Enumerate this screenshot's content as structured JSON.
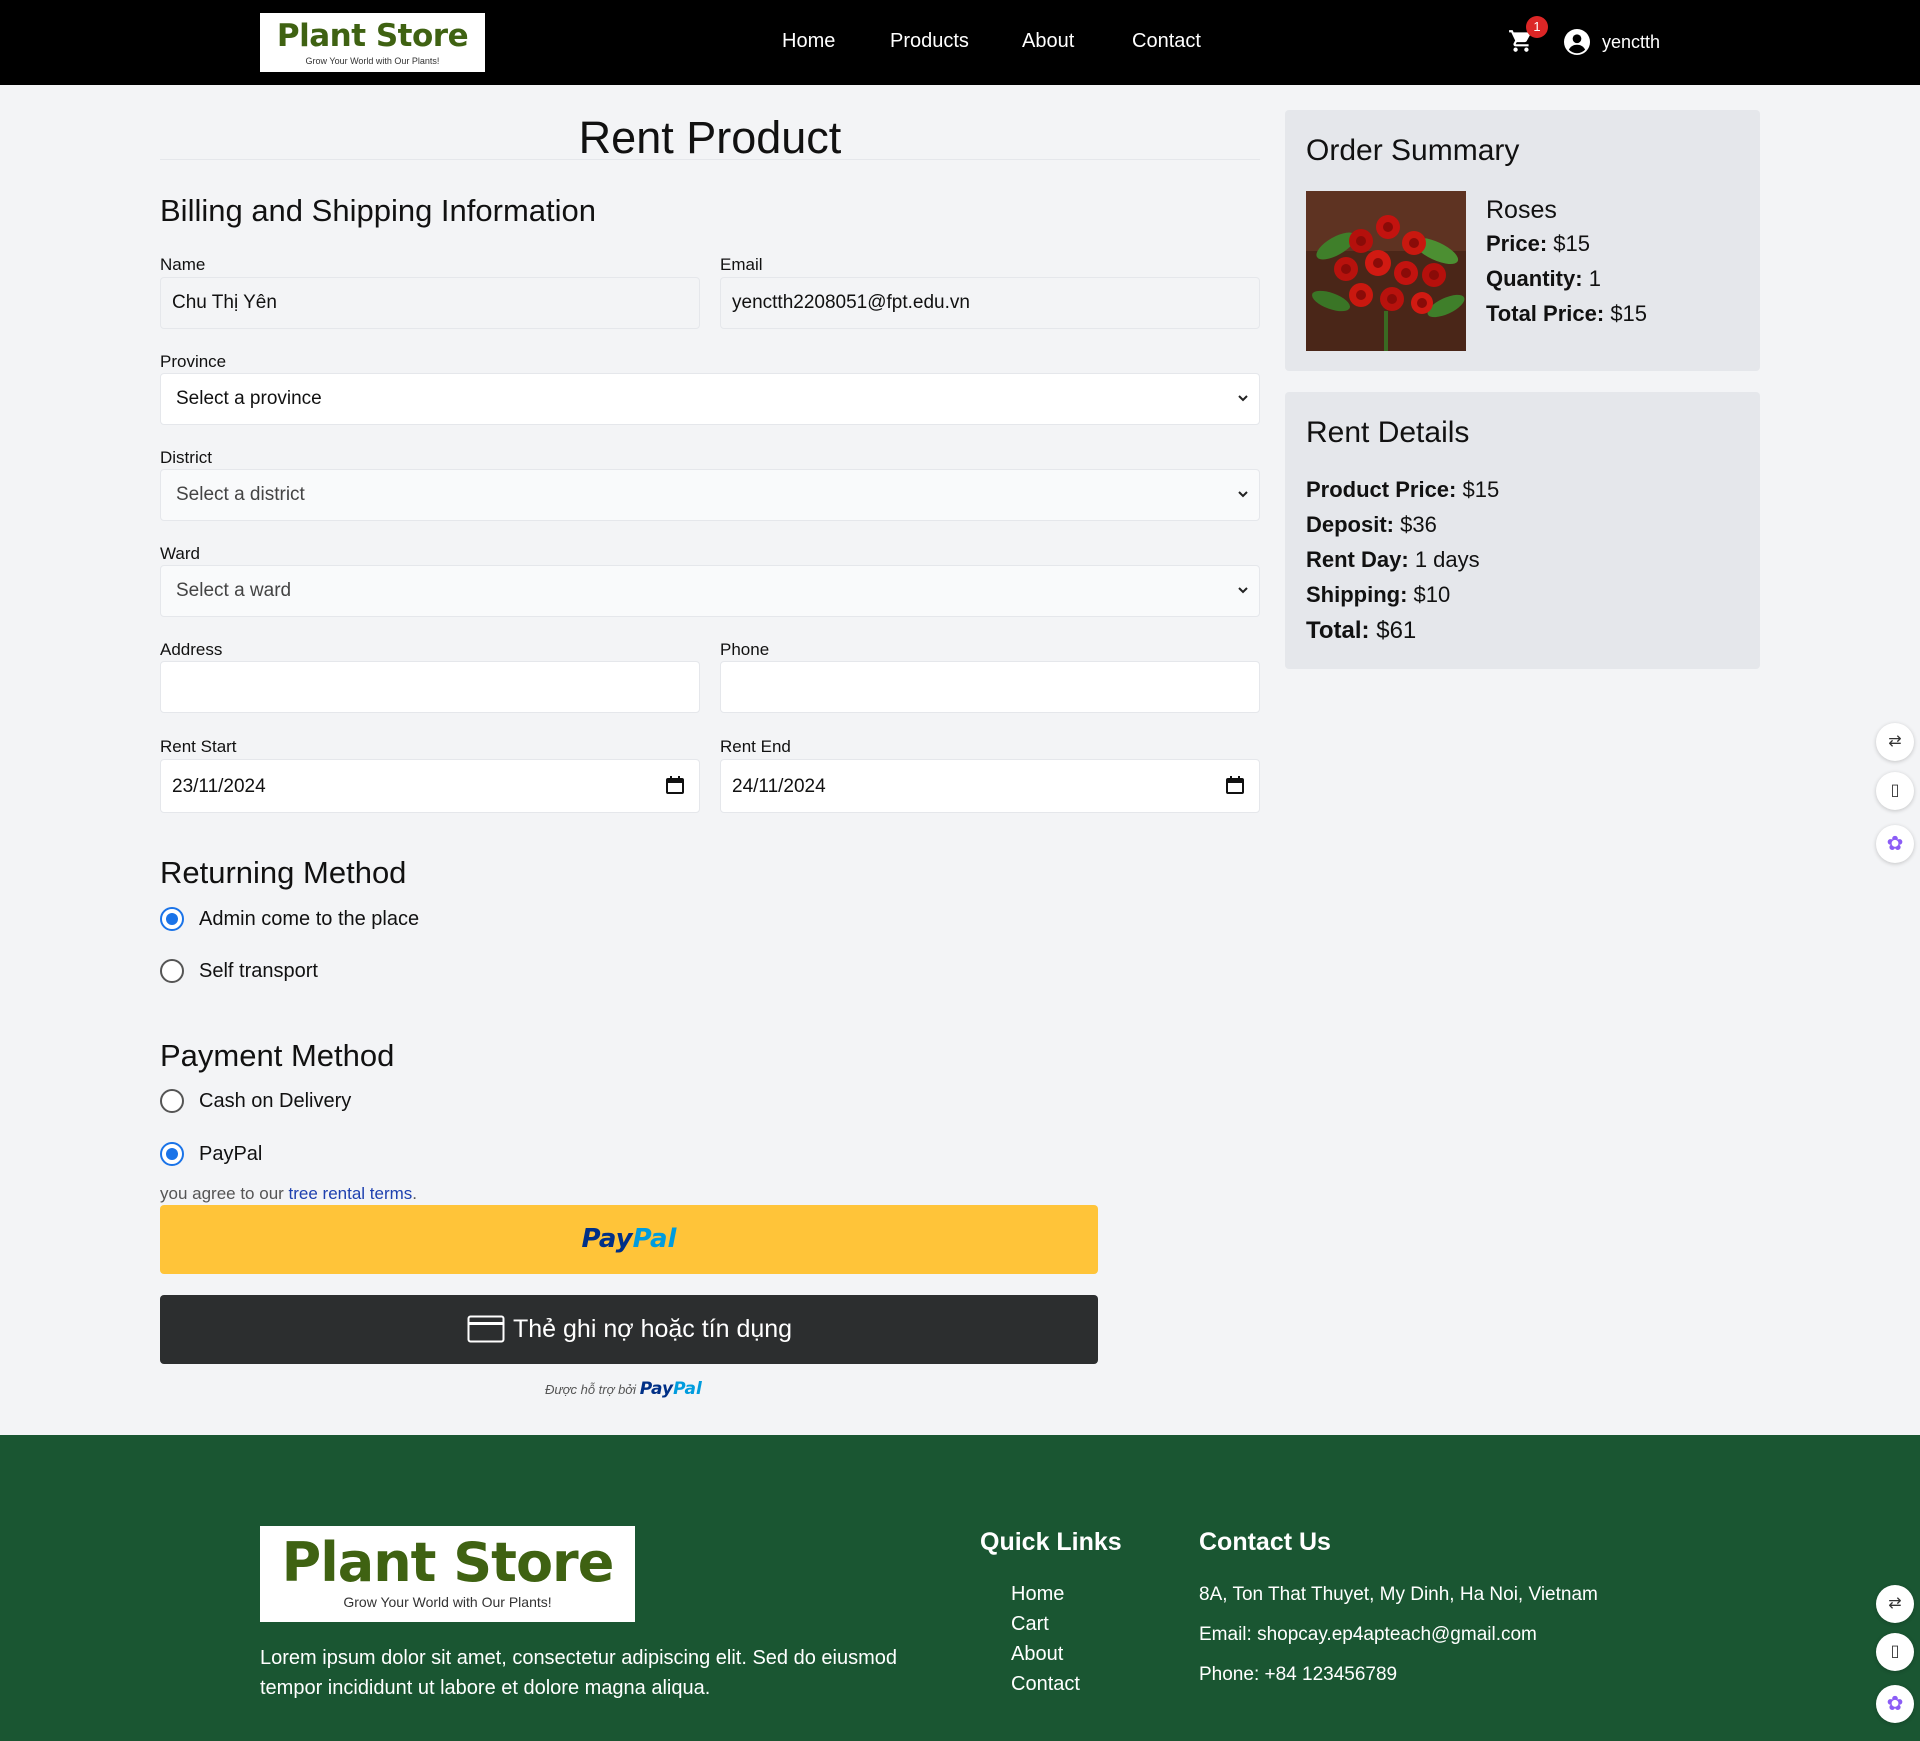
{
  "header": {
    "logo_title": "Plant Store",
    "logo_slogan": "Grow Your World with Our Plants!",
    "nav": [
      "Home",
      "Products",
      "About",
      "Contact"
    ],
    "cart_count": "1",
    "username": "yenctth"
  },
  "form": {
    "page_title": "Rent Product",
    "billing_heading": "Billing and Shipping Information",
    "name_label": "Name",
    "name_value": "Chu Thị Yên",
    "email_label": "Email",
    "email_value": "yenctth2208051@fpt.edu.vn",
    "province_label": "Province",
    "province_value": "Select a province",
    "district_label": "District",
    "district_value": "Select a district",
    "ward_label": "Ward",
    "ward_value": "Select a ward",
    "address_label": "Address",
    "address_value": "",
    "phone_label": "Phone",
    "phone_value": "",
    "rent_start_label": "Rent Start",
    "rent_start_value": "23/11/2024",
    "rent_end_label": "Rent End",
    "rent_end_value": "24/11/2024",
    "returning_heading": "Returning Method",
    "returning_options": [
      {
        "label": "Admin come to the place",
        "selected": true
      },
      {
        "label": "Self transport",
        "selected": false
      }
    ],
    "payment_heading": "Payment Method",
    "payment_options": [
      {
        "label": "Cash on Delivery",
        "selected": false
      },
      {
        "label": "PayPal",
        "selected": true
      }
    ],
    "terms_prefix": "you agree to our ",
    "terms_link": "tree rental terms",
    "terms_suffix": ".",
    "paypal_pay": "Pay",
    "paypal_pal": "Pal",
    "card_button": "Thẻ ghi nợ hoặc tín dụng",
    "powered_by": "Được hỗ trợ bởi",
    "accent_color": "#1a73e8",
    "paypal_button_color": "#ffc439"
  },
  "order_summary": {
    "title": "Order Summary",
    "product_name": "Roses",
    "price_label": "Price:",
    "price_value": "$15",
    "quantity_label": "Quantity:",
    "quantity_value": "1",
    "total_label": "Total Price:",
    "total_value": "$15"
  },
  "rent_details": {
    "title": "Rent Details",
    "rows": [
      {
        "label": "Product Price:",
        "value": "$15"
      },
      {
        "label": "Deposit:",
        "value": "$36"
      },
      {
        "label": "Rent Day:",
        "value": "1 days"
      },
      {
        "label": "Shipping:",
        "value": "$10"
      },
      {
        "label": "Total:",
        "value": "$61"
      }
    ]
  },
  "footer": {
    "logo_title": "Plant Store",
    "logo_slogan": "Grow Your World with Our Plants!",
    "about": "Lorem ipsum dolor sit amet, consectetur adipiscing elit. Sed do eiusmod tempor incididunt ut labore et dolore magna aliqua.",
    "quick_links_heading": "Quick Links",
    "quick_links": [
      "Home",
      "Cart",
      "About",
      "Contact"
    ],
    "contact_heading": "Contact Us",
    "address": "8A, Ton That Thuyet, My Dinh, Ha Noi, Vietnam",
    "email": "Email: shopcay.ep4apteach@gmail.com",
    "phone": "Phone: +84 123456789",
    "background_color": "#1a5632"
  }
}
